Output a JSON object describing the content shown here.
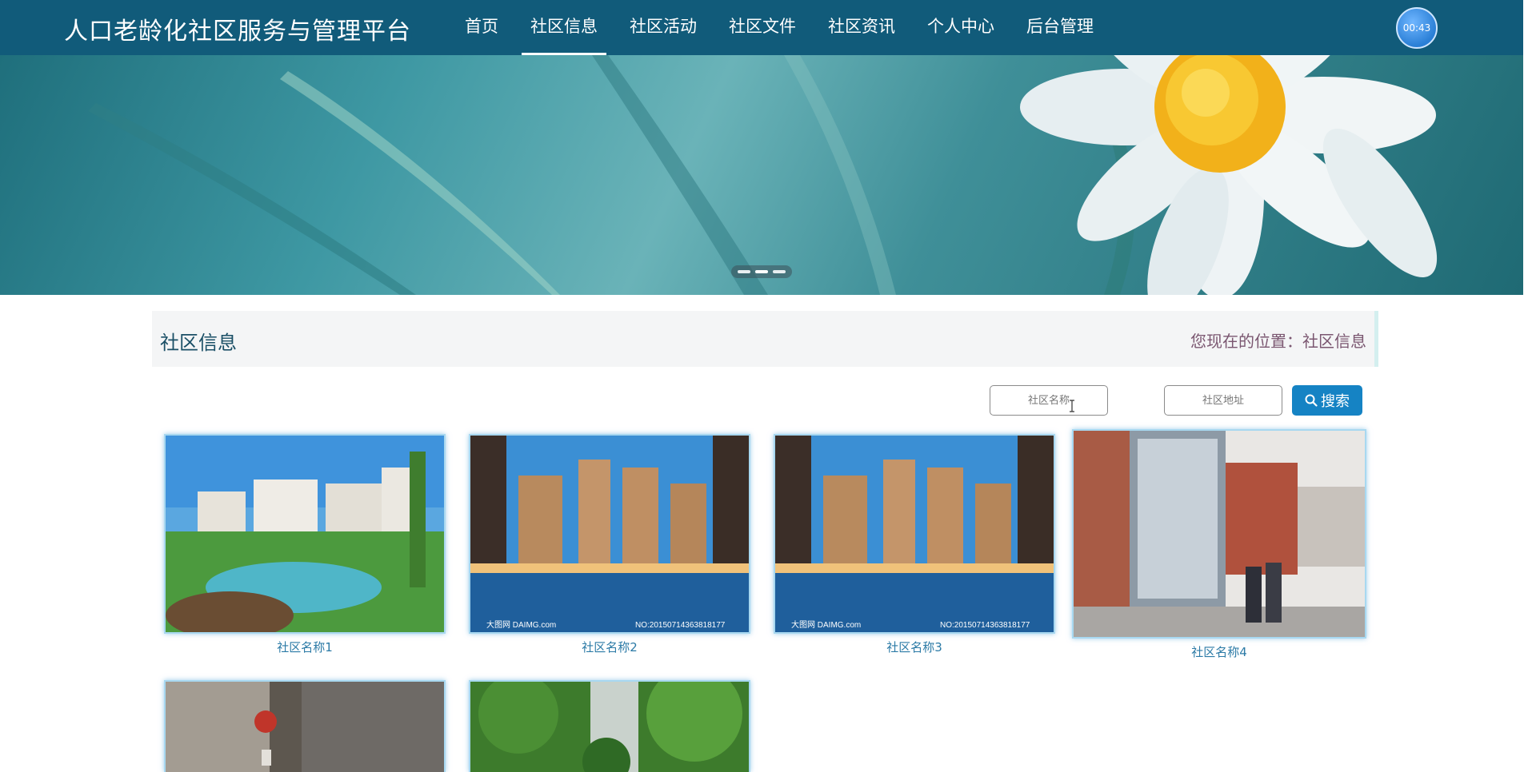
{
  "header": {
    "site_title": "人口老龄化社区服务与管理平台",
    "nav": [
      {
        "label": "首页",
        "active": false
      },
      {
        "label": "社区信息",
        "active": true
      },
      {
        "label": "社区活动",
        "active": false
      },
      {
        "label": "社区文件",
        "active": false
      },
      {
        "label": "社区资讯",
        "active": false
      },
      {
        "label": "个人中心",
        "active": false
      },
      {
        "label": "后台管理",
        "active": false
      }
    ],
    "timer": "00:43"
  },
  "banner": {
    "slide_count": 3
  },
  "section": {
    "title": "社区信息",
    "breadcrumb": "您现在的位置：社区信息"
  },
  "search": {
    "name_placeholder": "社区名称",
    "address_placeholder": "社区地址",
    "button_label": "搜索"
  },
  "communities": [
    {
      "name": "社区名称1",
      "image": "garden-apartments"
    },
    {
      "name": "社区名称2",
      "image": "pool-towers",
      "watermark_left": "大图网 DAIMG.com",
      "watermark_right": "NO:20150714363818177"
    },
    {
      "name": "社区名称3",
      "image": "pool-towers",
      "watermark_left": "大图网 DAIMG.com",
      "watermark_right": "NO:20150714363818177"
    },
    {
      "name": "社区名称4",
      "image": "elevator-street"
    },
    {
      "name": "",
      "image": "lobby-elevator"
    },
    {
      "name": "",
      "image": "green-courtyard"
    }
  ],
  "colors": {
    "nav_bg": "#115b7a",
    "accent": "#1583c4",
    "title_text": "#1a4f66",
    "link_text": "#2b7aa6"
  }
}
